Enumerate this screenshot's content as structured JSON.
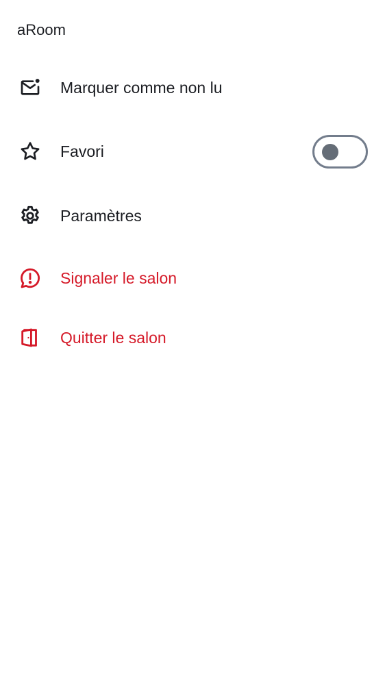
{
  "header": {
    "room_name": "aRoom"
  },
  "menu": {
    "items": [
      {
        "id": "mark-unread",
        "label": "Marquer comme non lu",
        "icon": "mark-unread-icon"
      },
      {
        "id": "favourite",
        "label": "Favori",
        "icon": "star-icon",
        "toggle_state": "off"
      },
      {
        "id": "settings",
        "label": "Paramètres",
        "icon": "gear-icon"
      },
      {
        "id": "report",
        "label": "Signaler le salon",
        "icon": "report-icon",
        "danger": true
      },
      {
        "id": "leave",
        "label": "Quitter le salon",
        "icon": "leave-door-icon",
        "danger": true
      }
    ]
  },
  "colors": {
    "text": "#1b1d22",
    "danger": "#d51928",
    "toggle_off": "#737d8c"
  }
}
